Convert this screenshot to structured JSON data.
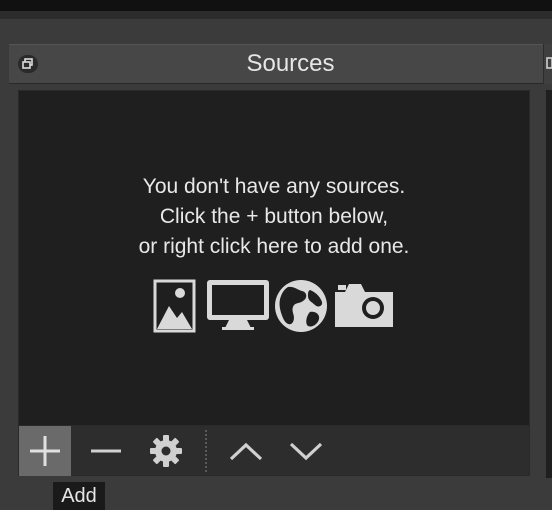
{
  "dock": {
    "title": "Sources"
  },
  "empty_state": {
    "line1": "You don't have any sources.",
    "line2": "Click the + button below,",
    "line3": "or right click here to add one.",
    "icons": [
      "image-icon",
      "display-icon",
      "globe-icon",
      "camera-icon"
    ]
  },
  "toolbar": {
    "buttons": [
      "add",
      "remove",
      "properties",
      "move-up",
      "move-down"
    ]
  },
  "tooltip": {
    "text": "Add"
  },
  "colors": {
    "panel_bg": "#1f1f1f",
    "title_bar": "#474747",
    "toolbar_bg": "#2d2d2d",
    "button_active": "#6a6a6a",
    "text": "#e6e6e6",
    "icon": "#d9d9d9"
  }
}
